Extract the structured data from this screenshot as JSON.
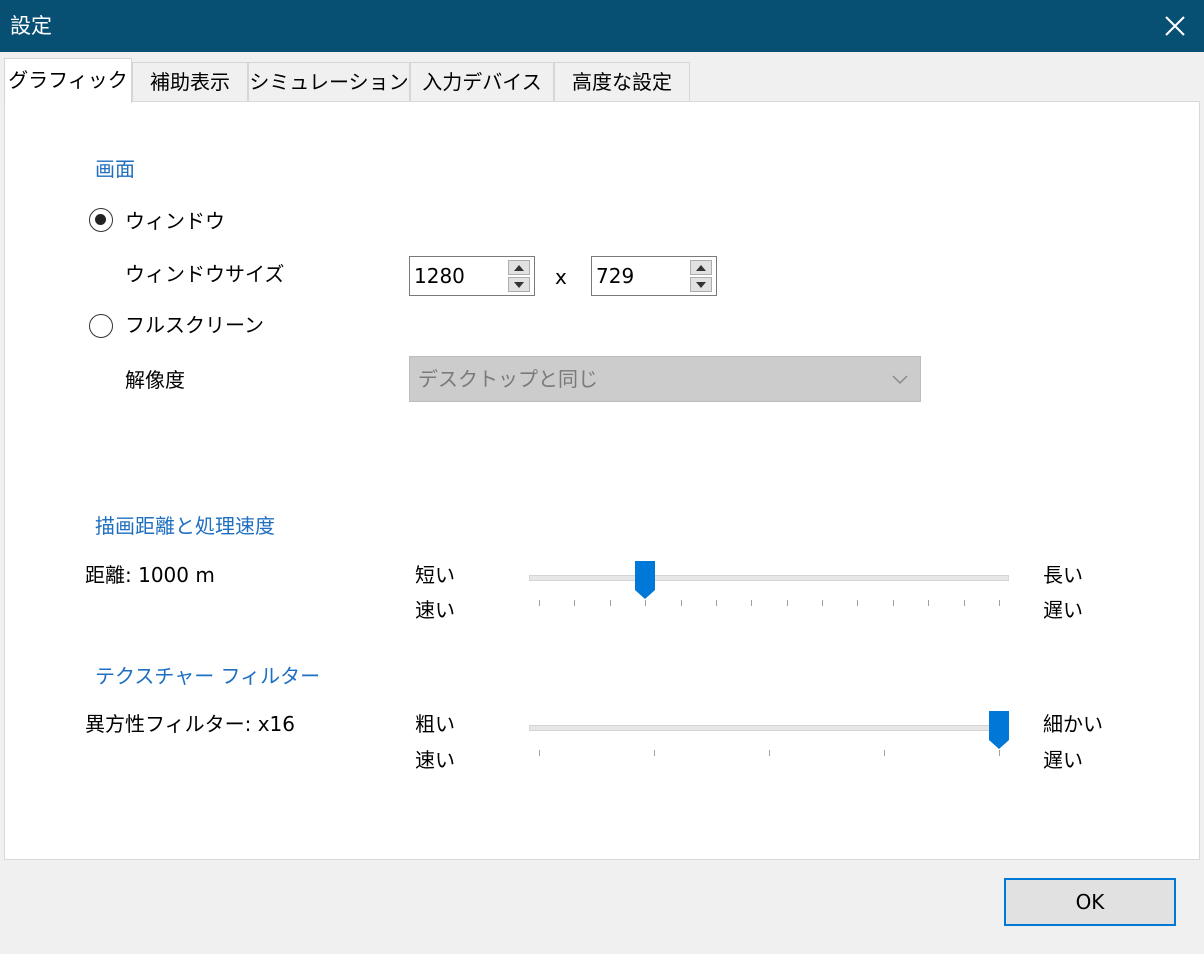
{
  "window": {
    "title": "設定"
  },
  "tabs": [
    {
      "label": "グラフィック",
      "active": true
    },
    {
      "label": "補助表示"
    },
    {
      "label": "シミュレーション"
    },
    {
      "label": "入力デバイス"
    },
    {
      "label": "高度な設定"
    }
  ],
  "display": {
    "section_title": "画面",
    "window_radio_label": "ウィンドウ",
    "window_size_label": "ウィンドウサイズ",
    "width_value": "1280",
    "size_separator": "x",
    "height_value": "729",
    "fullscreen_radio_label": "フルスクリーン",
    "resolution_label": "解像度",
    "resolution_value": "デスクトップと同じ",
    "selected_mode": "window"
  },
  "draw_distance": {
    "section_title": "描画距離と処理速度",
    "value_label": "距離: 1000 m",
    "left_label_top": "短い",
    "left_label_bottom": "速い",
    "right_label_top": "長い",
    "right_label_bottom": "遅い",
    "tick_count": 14,
    "position": 0.231
  },
  "texture_filter": {
    "section_title": "テクスチャー フィルター",
    "value_label": "異方性フィルター: x16",
    "left_label_top": "粗い",
    "left_label_bottom": "速い",
    "right_label_top": "細かい",
    "right_label_bottom": "遅い",
    "tick_count": 5,
    "position": 1.0
  },
  "footer": {
    "ok_label": "OK"
  },
  "colors": {
    "titlebar": "#084f74",
    "accent": "#0078d7",
    "section": "#1f6fc0"
  },
  "icons": {
    "close": "close-icon",
    "spin_up": "spin-up-icon",
    "spin_down": "spin-down-icon",
    "dropdown": "chevron-down-icon"
  }
}
